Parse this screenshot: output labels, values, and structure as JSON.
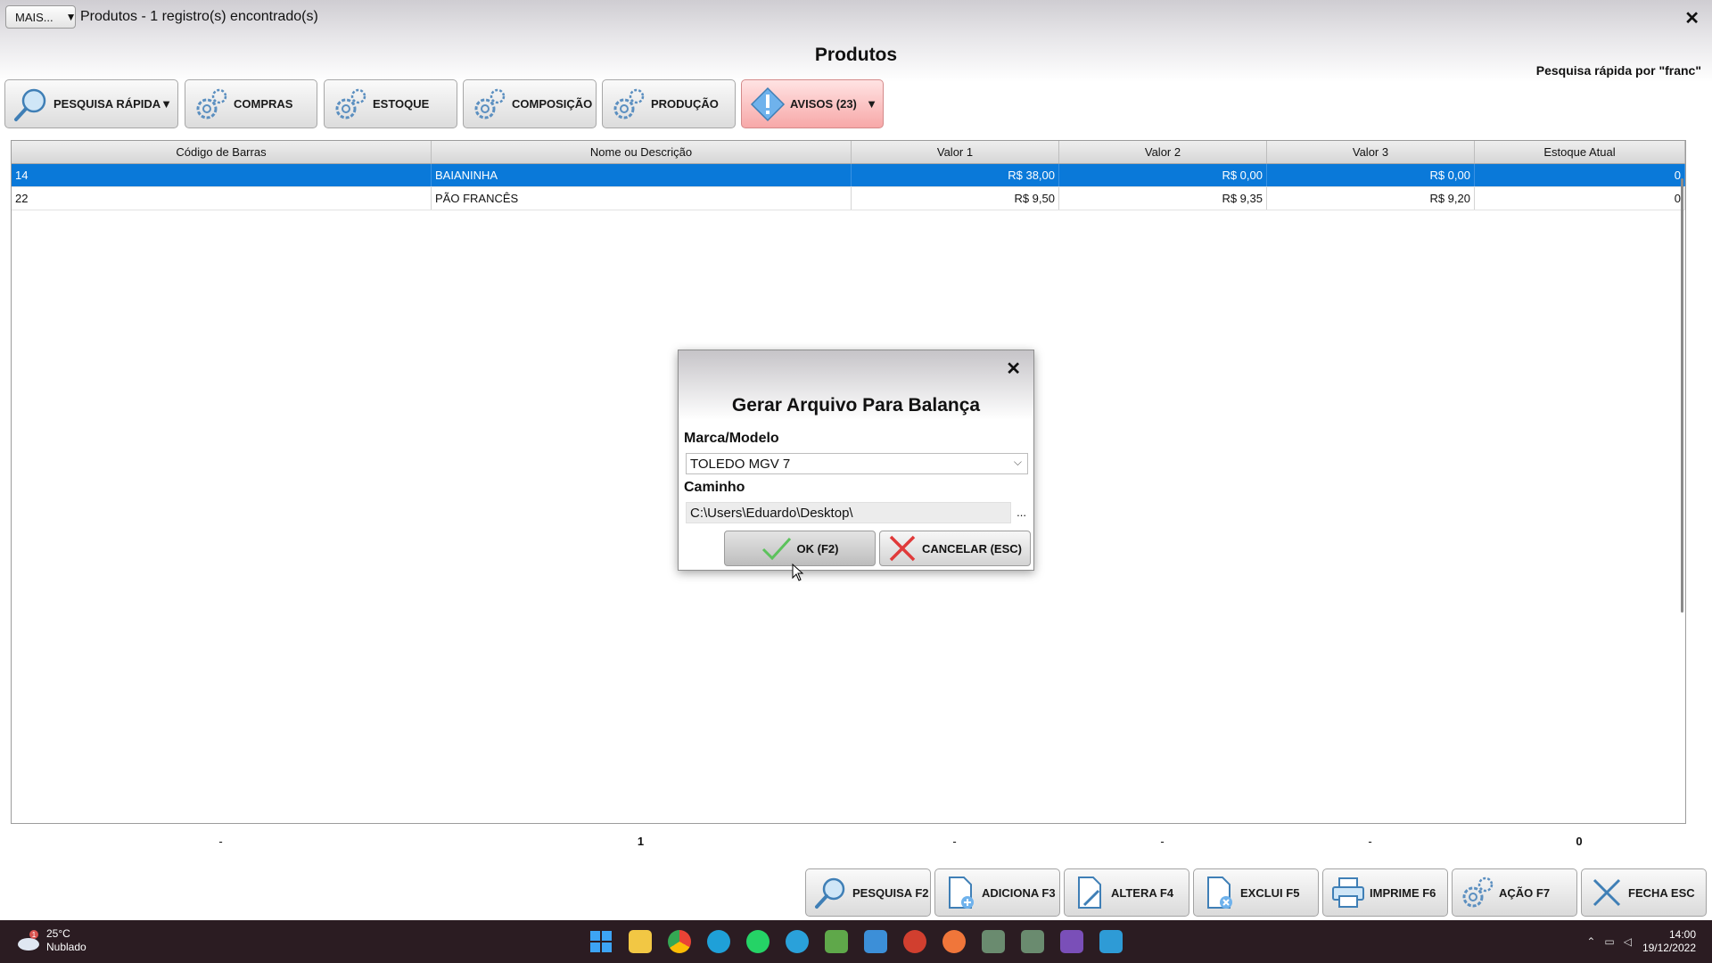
{
  "titlebar": {
    "mais_label": "MAIS...",
    "title": "Produtos - 1 registro(s) encontrado(s)",
    "close": "✕"
  },
  "page": {
    "title": "Produtos",
    "quick_search_info": "Pesquisa rápida por \"franc\""
  },
  "toolbar": {
    "quick_search": "PESQUISA RÁPIDA",
    "compras": "COMPRAS",
    "estoque": "ESTOQUE",
    "composicao": "COMPOSIÇÃO",
    "producao": "PRODUÇÃO",
    "avisos": "AVISOS (23)"
  },
  "table": {
    "columns": [
      "Código de Barras",
      "Nome ou Descrição",
      "Valor 1",
      "Valor 2",
      "Valor 3",
      "Estoque Atual"
    ],
    "rows": [
      [
        "14",
        "BAIANINHA",
        "R$ 38,00",
        "R$ 0,00",
        "R$ 0,00",
        "0"
      ],
      [
        "22",
        "PÃO FRANCÊS",
        "R$ 9,50",
        "R$ 9,35",
        "R$ 9,20",
        "0"
      ]
    ],
    "selected_row": 0,
    "totals": [
      "-",
      "1",
      "-",
      "-",
      "-",
      "0"
    ]
  },
  "actions": {
    "pesquisa": "PESQUISA F2",
    "adiciona": "ADICIONA F3",
    "altera": "ALTERA F4",
    "exclui": "EXCLUI F5",
    "imprime": "IMPRIME F6",
    "acao": "AÇÃO F7",
    "fecha": "FECHA ESC"
  },
  "dialog": {
    "title": "Gerar Arquivo Para Balança",
    "close": "✕",
    "marca_label": "Marca/Modelo",
    "marca_value": "TOLEDO MGV 7",
    "caminho_label": "Caminho",
    "caminho_value": "C:\\Users\\Eduardo\\Desktop\\",
    "browse": "...",
    "ok": "OK (F2)",
    "cancel": "CANCELAR (ESC)"
  },
  "taskbar": {
    "weather_temp": "25°C",
    "weather_desc": "Nublado",
    "weather_badge": "1",
    "time": "14:00",
    "date": "19/12/2022"
  },
  "colors": {
    "selected_row": "#0a79d9",
    "warn_button": "#f7a8a8",
    "taskbar": "#2b1c22"
  }
}
